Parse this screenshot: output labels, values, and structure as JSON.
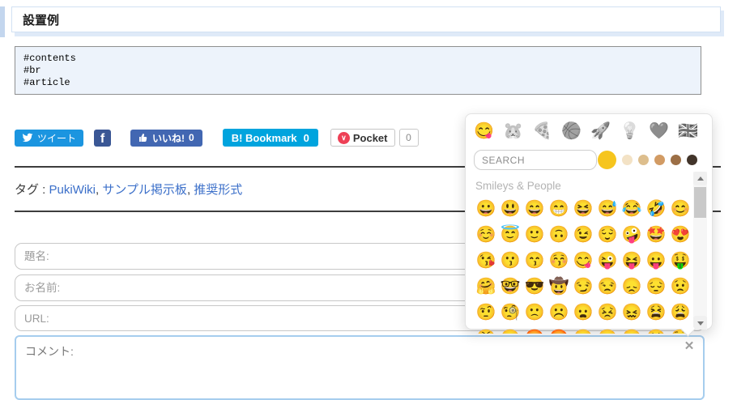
{
  "page": {
    "heading": "設置例",
    "code_lines": [
      "#contents",
      "#br",
      "#article"
    ]
  },
  "social": {
    "tweet_label": "ツイート",
    "facebook_letter": "f",
    "like_label": "いいね!",
    "like_count": "0",
    "hatena_label": "B! Bookmark",
    "hatena_count": "0",
    "pocket_label": "Pocket",
    "pocket_chevron": "∨",
    "pocket_count": "0",
    "colors": {
      "twitter": "#1b95e0",
      "facebook": "#3a5795",
      "like": "#4267b2",
      "hatena": "#00a4de",
      "pocket_red": "#ee4056"
    }
  },
  "tags": {
    "label": "タグ :",
    "separator": ", ",
    "items": [
      "PukiWiki",
      "サンプル掲示板",
      "推奨形式"
    ]
  },
  "form": {
    "title_placeholder": "題名:",
    "name_placeholder": "お名前:",
    "url_placeholder": "URL:",
    "comment_placeholder": "コメント:",
    "close_icon": "✕"
  },
  "emoji_picker": {
    "categories": [
      {
        "name": "smileys-people",
        "icon": "😋",
        "active": true
      },
      {
        "name": "animals-nature",
        "icon": "🐹",
        "active": false
      },
      {
        "name": "food-drink",
        "icon": "🍕",
        "active": false
      },
      {
        "name": "activity",
        "icon": "🏀",
        "active": false
      },
      {
        "name": "travel-places",
        "icon": "🚀",
        "active": false
      },
      {
        "name": "objects",
        "icon": "💡",
        "active": false
      },
      {
        "name": "symbols",
        "icon": "❤️",
        "active": false
      },
      {
        "name": "flags",
        "icon": "🇬🇧",
        "active": false
      }
    ],
    "search_placeholder": "SEARCH",
    "skin_tones": [
      "#f6c51d",
      "#f3e2c5",
      "#ddbe8d",
      "#d29b64",
      "#9c6f46",
      "#42342a"
    ],
    "selected_tone_index": 0,
    "section_title": "Smileys & People",
    "emojis": [
      "😀",
      "😃",
      "😄",
      "😁",
      "😆",
      "😅",
      "😂",
      "🤣",
      "😊",
      "☺️",
      "😇",
      "🙂",
      "🙃",
      "😉",
      "😌",
      "🤪",
      "🤩",
      "😍",
      "😘",
      "😗",
      "😙",
      "😚",
      "😋",
      "😜",
      "😝",
      "😛",
      "🤑",
      "🤗",
      "🤓",
      "😎",
      "🤠",
      "😏",
      "😒",
      "😞",
      "😔",
      "😟",
      "🤨",
      "🧐",
      "🙁",
      "☹️",
      "😦",
      "😣",
      "😖",
      "😫",
      "😩",
      "😤",
      "😠",
      "🤬",
      "😡",
      "😶",
      "😐",
      "😑",
      "🥺",
      "😳"
    ]
  }
}
